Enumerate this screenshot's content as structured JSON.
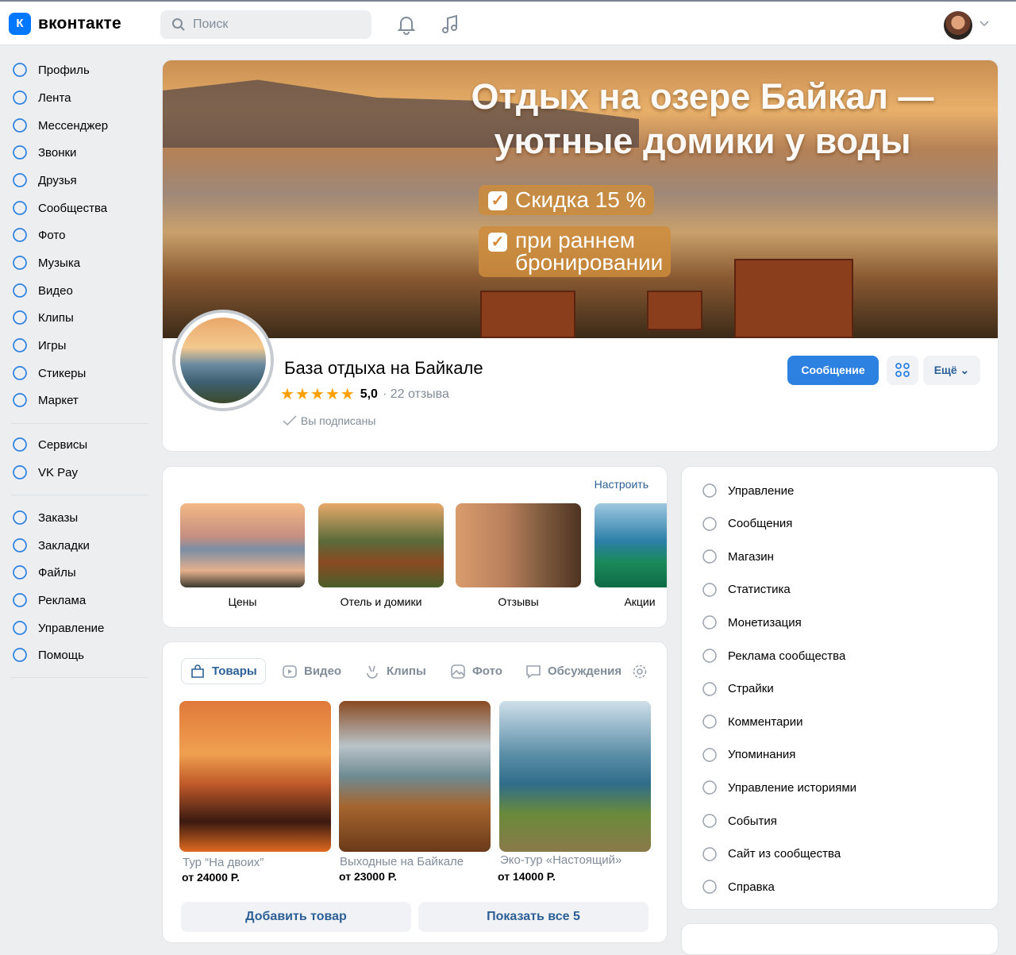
{
  "header": {
    "logo_text": "вконтакте",
    "search_placeholder": "Поиск"
  },
  "sidebar": {
    "items": [
      {
        "label": "Профиль",
        "icon": "user-circle-icon"
      },
      {
        "label": "Лента",
        "icon": "feed-icon"
      },
      {
        "label": "Мессенджер",
        "icon": "message-icon"
      },
      {
        "label": "Звонки",
        "icon": "phone-icon"
      },
      {
        "label": "Друзья",
        "icon": "friends-icon"
      },
      {
        "label": "Сообщества",
        "icon": "communities-icon"
      },
      {
        "label": "Фото",
        "icon": "photo-icon"
      },
      {
        "label": "Музыка",
        "icon": "music-icon"
      },
      {
        "label": "Видео",
        "icon": "video-icon"
      },
      {
        "label": "Клипы",
        "icon": "clips-icon"
      },
      {
        "label": "Игры",
        "icon": "gamepad-icon"
      },
      {
        "label": "Стикеры",
        "icon": "smile-icon"
      },
      {
        "label": "Маркет",
        "icon": "bag-icon"
      },
      {
        "label": "Сервисы",
        "icon": "grid-icon"
      },
      {
        "label": "VK Pay",
        "icon": "ruble-icon"
      },
      {
        "label": "Заказы",
        "icon": "box-icon"
      },
      {
        "label": "Закладки",
        "icon": "bookmark-icon"
      },
      {
        "label": "Файлы",
        "icon": "file-icon"
      },
      {
        "label": "Реклама",
        "icon": "megaphone-icon"
      },
      {
        "label": "Управление",
        "icon": "grid-icon"
      },
      {
        "label": "Помощь",
        "icon": "help-icon"
      }
    ]
  },
  "cover": {
    "headline1": "Отдых на озере Байкал —",
    "headline2": "уютные домики у воды",
    "badge1": "Скидка 15 %",
    "badge2a": "при раннем",
    "badge2b": "бронировании"
  },
  "profile": {
    "name": "База отдыха на Байкале",
    "rating": "5,0",
    "reviews": "22 отзыва",
    "stars": 5,
    "subscribed": "Вы подписаны",
    "message_button": "Сообщение",
    "more_button": "Ещё"
  },
  "gallery": {
    "configure": "Настроить",
    "items": [
      "Цены",
      "Отель и домики",
      "Отзывы",
      "Акции"
    ]
  },
  "tabs": [
    "Товары",
    "Видео",
    "Клипы",
    "Фото",
    "Обсуждения"
  ],
  "products": [
    {
      "name": "Тур “На двоих”",
      "price": "от 24000 Р."
    },
    {
      "name": "Выходные на Байкале",
      "price": "от 23000 Р."
    },
    {
      "name": "Эко-тур «Настоящий»",
      "price": "от 14000 Р."
    }
  ],
  "product_buttons": {
    "add": "Добавить товар",
    "show_all": "Показать все 5"
  },
  "manage_menu": [
    "Управление",
    "Сообщения",
    "Магазин",
    "Статистика",
    "Монетизация",
    "Реклама сообщества",
    "Страйки",
    "Комментарии",
    "Упоминания",
    "Управление историями",
    "События",
    "Сайт из сообщества",
    "Справка"
  ],
  "colors": {
    "accent": "#0077ff",
    "button": "#2d81e0",
    "link": "#2c5f95",
    "star": "#ffa000"
  }
}
